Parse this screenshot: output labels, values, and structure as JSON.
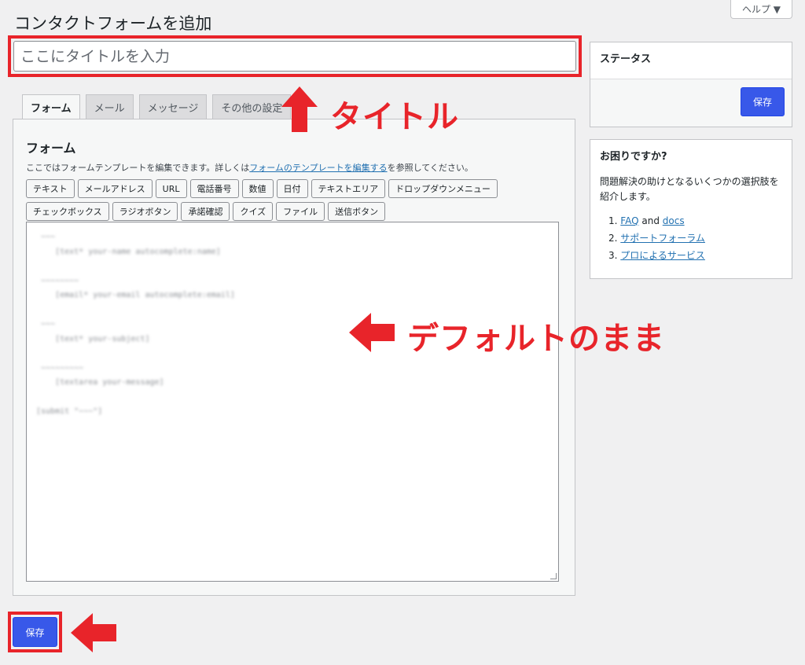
{
  "page": {
    "title": "コンタクトフォームを追加",
    "help_label": "ヘルプ ▼"
  },
  "title_field": {
    "placeholder": "ここにタイトルを入力",
    "value": ""
  },
  "tabs": [
    {
      "label": "フォーム",
      "active": true
    },
    {
      "label": "メール",
      "active": false
    },
    {
      "label": "メッセージ",
      "active": false
    },
    {
      "label": "その他の設定",
      "active": false
    }
  ],
  "form_panel": {
    "heading": "フォーム",
    "description_prefix": "ここではフォームテンプレートを編集できます。詳しくは",
    "description_link": "フォームのテンプレートを編集する",
    "description_suffix": "を参照してください。",
    "tag_buttons_row1": [
      "テキスト",
      "メールアドレス",
      "URL",
      "電話番号",
      "数値",
      "日付",
      "テキストエリア",
      "ドロップダウンメニュー"
    ],
    "tag_buttons_row2": [
      "チェックボックス",
      "ラジオボタン",
      "承諾確認",
      "クイズ",
      "ファイル",
      "送信ボタン"
    ]
  },
  "status_box": {
    "title": "ステータス",
    "save_label": "保存"
  },
  "help_box": {
    "title": "お困りですか?",
    "text": "問題解決の助けとなるいくつかの選択肢を紹介します。",
    "item1_num": "1.",
    "item1_link_a": "FAQ",
    "item1_and": "and",
    "item1_link_b": "docs",
    "item2_num": "2.",
    "item2_link": "サポートフォーラム",
    "item3_num": "3.",
    "item3_link": "プロによるサービス"
  },
  "bottom_save_label": "保存",
  "annotations": {
    "title_note": "タイトル",
    "default_note": "デフォルトのまま",
    "color": "#e8242a"
  }
}
